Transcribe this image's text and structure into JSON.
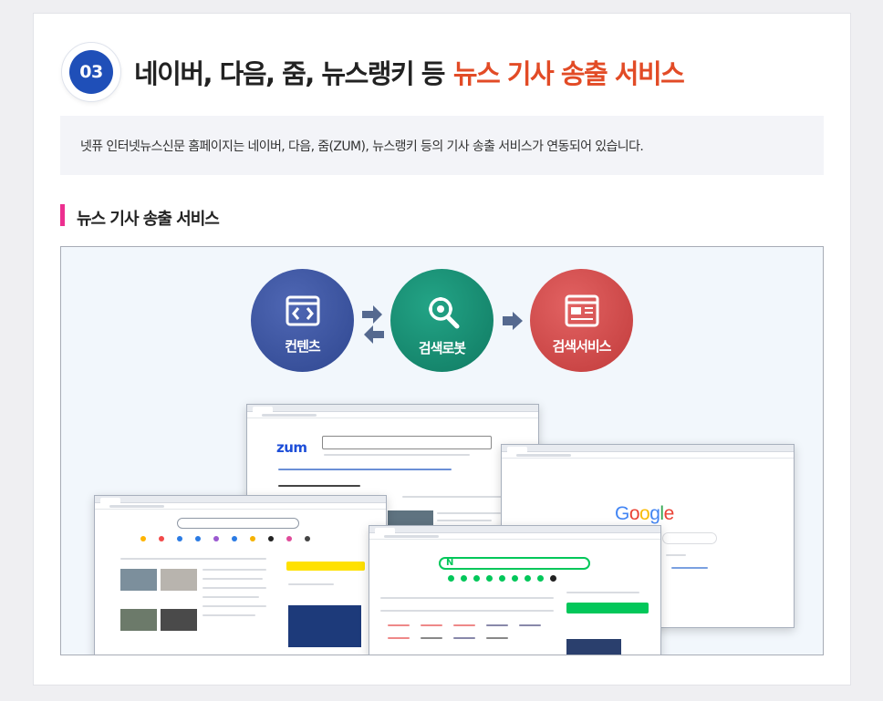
{
  "section": {
    "number": "03",
    "title_main": "네이버, 다음, 줌, 뉴스랭키 등",
    "title_highlight": "뉴스 기사 송출 서비스",
    "description": "넷퓨 인터넷뉴스신문 홈페이지는 네이버, 다음, 줌(ZUM), 뉴스랭키 등의 기사 송출 서비스가 연동되어 있습니다.",
    "subtitle": "뉴스 기사 송출 서비스"
  },
  "flow": [
    {
      "label": "컨텐츠",
      "icon": "code-window-icon",
      "color": "#3b55a3"
    },
    {
      "label": "검색로봇",
      "icon": "search-gear-icon",
      "color": "#188f73"
    },
    {
      "label": "검색서비스",
      "icon": "web-page-icon",
      "color": "#d24e4e"
    }
  ],
  "colors": {
    "accent_red": "#e24b26",
    "badge_blue": "#1f4fb8",
    "section_bar": "#ec2f8f"
  },
  "screenshots": {
    "zum": {
      "logo": "zum"
    },
    "google": {
      "logo_parts": [
        "G",
        "o",
        "o",
        "g",
        "l",
        "e"
      ]
    },
    "naver": {
      "logo": "N"
    }
  }
}
